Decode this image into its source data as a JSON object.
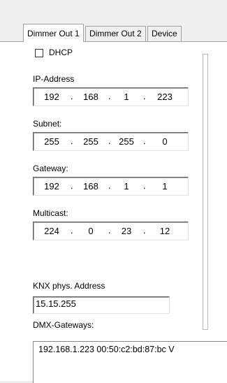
{
  "tabs": [
    {
      "label": "Dimmer Out 1"
    },
    {
      "label": "Dimmer Out 2"
    },
    {
      "label": "Device"
    }
  ],
  "dhcp": {
    "label": "DHCP",
    "checked": false
  },
  "ip_address": {
    "label": "IP-Address",
    "octets": [
      "192",
      "168",
      "1",
      "223"
    ]
  },
  "subnet": {
    "label": "Subnet:",
    "octets": [
      "255",
      "255",
      "255",
      "0"
    ]
  },
  "gateway": {
    "label": "Gateway:",
    "octets": [
      "192",
      "168",
      "1",
      "1"
    ]
  },
  "multicast": {
    "label": "Multicast:",
    "octets": [
      "224",
      "0",
      "23",
      "12"
    ]
  },
  "knx": {
    "label": "KNX phys. Address",
    "value": "15.15.255"
  },
  "dmx_gateways": {
    "label": "DMX-Gateways:",
    "items": [
      "192.168.1.223 00:50:c2:bd:87:bc   V"
    ]
  }
}
